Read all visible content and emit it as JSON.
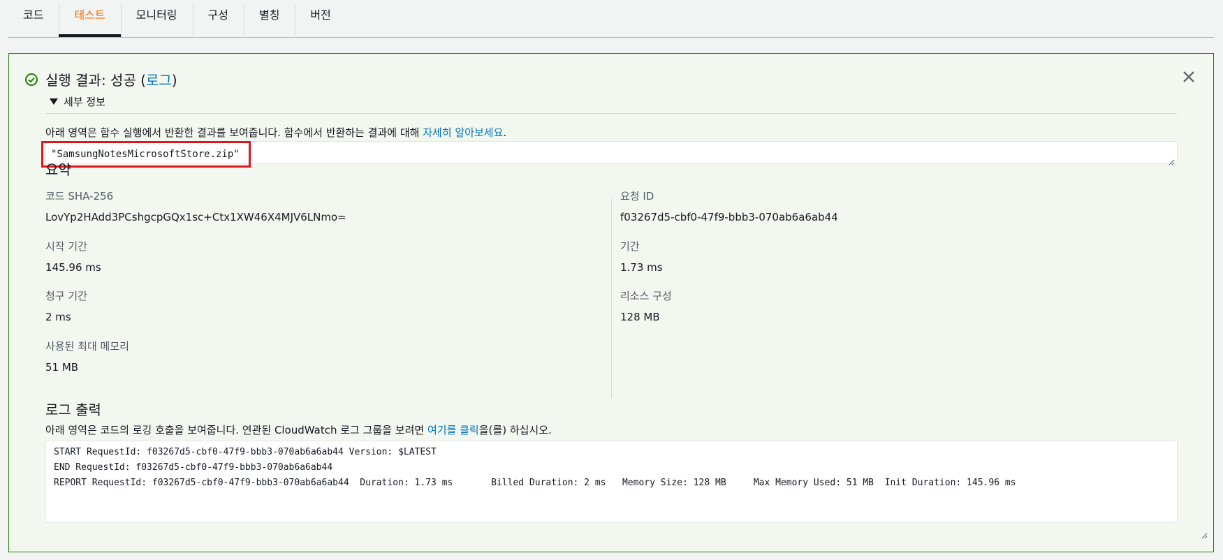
{
  "tabs": [
    {
      "label": "코드",
      "active": false
    },
    {
      "label": "테스트",
      "active": true
    },
    {
      "label": "모니터링",
      "active": false
    },
    {
      "label": "구성",
      "active": false
    },
    {
      "label": "별칭",
      "active": false
    },
    {
      "label": "버전",
      "active": false
    }
  ],
  "result": {
    "title_prefix": "실행 결과: 성공 (",
    "log_link": "로그",
    "title_suffix": ")",
    "status_color": "#1d8102",
    "details_label": "세부 정보",
    "description_text": "아래 영역은 함수 실행에서 반환한 결과를 보여줍니다. 함수에서 반환하는 결과에 대해 ",
    "description_link": "자세히 알아보세요",
    "description_end": ".",
    "return_value": "\"SamsungNotesMicrosoftStore.zip\""
  },
  "summary": {
    "title": "요약",
    "items": [
      {
        "label": "코드 SHA-256",
        "value": "LovYp2HAdd3PCshgcpGQx1sc+Ctx1XW46X4MJV6LNmo="
      },
      {
        "label": "요청 ID",
        "value": "f03267d5-cbf0-47f9-bbb3-070ab6a6ab44"
      },
      {
        "label": "시작 기간",
        "value": "145.96 ms"
      },
      {
        "label": "기간",
        "value": "1.73 ms"
      },
      {
        "label": "청구 기간",
        "value": "2 ms"
      },
      {
        "label": "리소스 구성",
        "value": "128 MB"
      },
      {
        "label": "사용된 최대 메모리",
        "value": "51 MB"
      }
    ]
  },
  "log_output": {
    "title": "로그 출력",
    "description_text": "아래 영역은 코드의 로깅 호출을 보여줍니다. 연관된 CloudWatch 로그 그룹을 보려면 ",
    "description_link": "여기를 클릭",
    "description_end": "을(를) 하십시오.",
    "lines": [
      "START RequestId: f03267d5-cbf0-47f9-bbb3-070ab6a6ab44 Version: $LATEST",
      "END RequestId: f03267d5-cbf0-47f9-bbb3-070ab6a6ab44",
      "REPORT RequestId: f03267d5-cbf0-47f9-bbb3-070ab6a6ab44  Duration: 1.73 ms       Billed Duration: 2 ms   Memory Size: 128 MB     Max Memory Used: 51 MB  Init Duration: 145.96 ms"
    ]
  },
  "icons": {
    "success": "check-circle-icon",
    "close": "close-icon",
    "toggle": "caret-down-icon",
    "resize": "resize-handle-icon"
  }
}
